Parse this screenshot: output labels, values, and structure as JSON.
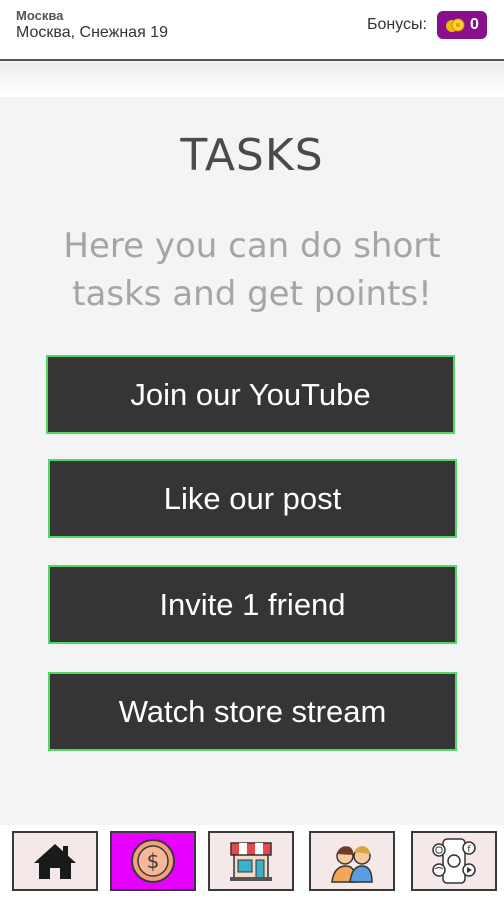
{
  "header": {
    "city": "Москва",
    "address": "Москва, Снежная 19",
    "bonus_label": "Бонусы:",
    "bonus_value": "0",
    "bonus_color": "#8a0f8c"
  },
  "main": {
    "title": "TASKS",
    "subtitle": "Here you can do short tasks and get points!",
    "tasks": [
      {
        "label": "Join our YouTube"
      },
      {
        "label": "Like our post"
      },
      {
        "label": "Invite 1 friend"
      },
      {
        "label": "Watch store stream"
      }
    ],
    "accent_color": "#4cd964"
  },
  "nav": {
    "items": [
      {
        "icon": "home-icon",
        "active": false
      },
      {
        "icon": "dollar-coin-icon",
        "active": true
      },
      {
        "icon": "store-icon",
        "active": false
      },
      {
        "icon": "friends-icon",
        "active": false
      },
      {
        "icon": "social-media-icon",
        "active": false
      }
    ],
    "active_color": "#e600ff"
  }
}
